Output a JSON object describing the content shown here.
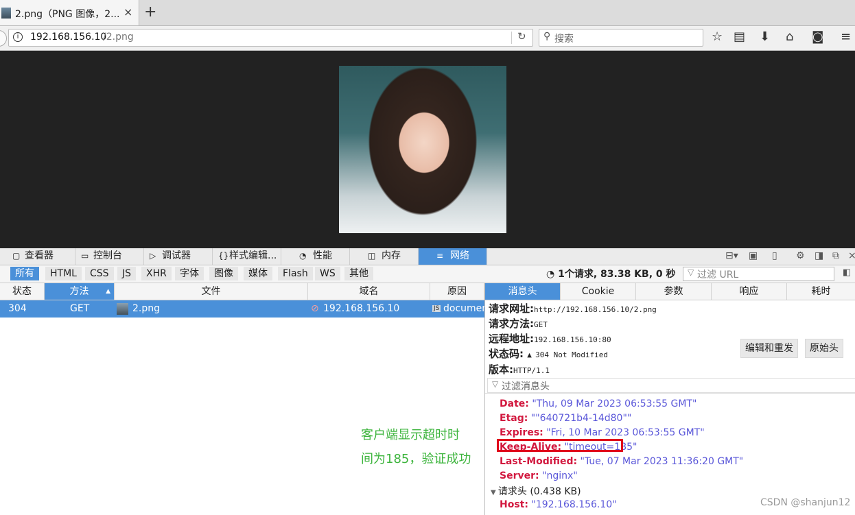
{
  "browser": {
    "tab_title": "2.png（PNG 图像，2...",
    "tab_close": "×",
    "new_tab": "+",
    "url_host": "192.168.156.10",
    "url_path": "/2.png",
    "search_placeholder": "搜索",
    "nav_icons": [
      "star-icon",
      "reading-list-icon",
      "download-icon",
      "home-icon",
      "pocket-icon",
      "menu-icon"
    ]
  },
  "devtools": {
    "tabs": [
      "查看器",
      "控制台",
      "调试器",
      "样式编辑...",
      "性能",
      "内存",
      "网络"
    ],
    "active_tab": "网络",
    "filters": [
      "所有",
      "HTML",
      "CSS",
      "JS",
      "XHR",
      "字体",
      "图像",
      "媒体",
      "Flash",
      "WS",
      "其他"
    ],
    "active_filter": "所有",
    "summary": "1个请求, 83.38 KB, 0 秒",
    "url_filter_placeholder": "过滤 URL",
    "columns": [
      "状态",
      "方法",
      "文件",
      "域名",
      "原因"
    ],
    "sorted_column": "方法",
    "request": {
      "status": "304",
      "method": "GET",
      "file": "2.png",
      "domain": "192.168.156.10",
      "cause": "documen"
    }
  },
  "annotation": {
    "line1": "客户端显示超时时",
    "line2": "间为185，验证成功"
  },
  "details": {
    "tabs": [
      "消息头",
      "Cookie",
      "参数",
      "响应",
      "耗时"
    ],
    "active_tab": "消息头",
    "request_url_label": "请求网址:",
    "request_url": "http://192.168.156.10/2.png",
    "method_label": "请求方法:",
    "method": "GET",
    "remote_label": "远程地址:",
    "remote": "192.168.156.10:80",
    "status_label": "状态码:",
    "status": "304 Not Modified",
    "version_label": "版本:",
    "version": "HTTP/1.1",
    "edit_resend": "编辑和重发",
    "raw_headers": "原始头",
    "header_filter_placeholder": "过滤消息头",
    "response_headers": [
      {
        "name": "Date:",
        "value": "\"Thu, 09 Mar 2023 06:53:55 GMT\""
      },
      {
        "name": "Etag:",
        "value": "\"\"640721b4-14d80\"\""
      },
      {
        "name": "Expires:",
        "value": "\"Fri, 10 Mar 2023 06:53:55 GMT\""
      },
      {
        "name": "Keep-Alive:",
        "value": "\"timeout=185\""
      },
      {
        "name": "Last-Modified:",
        "value": "\"Tue, 07 Mar 2023 11:36:20 GMT\""
      },
      {
        "name": "Server:",
        "value": "\"nginx\""
      }
    ],
    "request_headers_section": "请求头 (0.438 KB)",
    "host_header": {
      "name": "Host:",
      "value": "\"192.168.156.10\""
    }
  },
  "watermark": "CSDN @shanjun12",
  "colors": {
    "accent": "#4a90d9",
    "highlight": "#e0001a",
    "annotation": "#3cb43c"
  }
}
